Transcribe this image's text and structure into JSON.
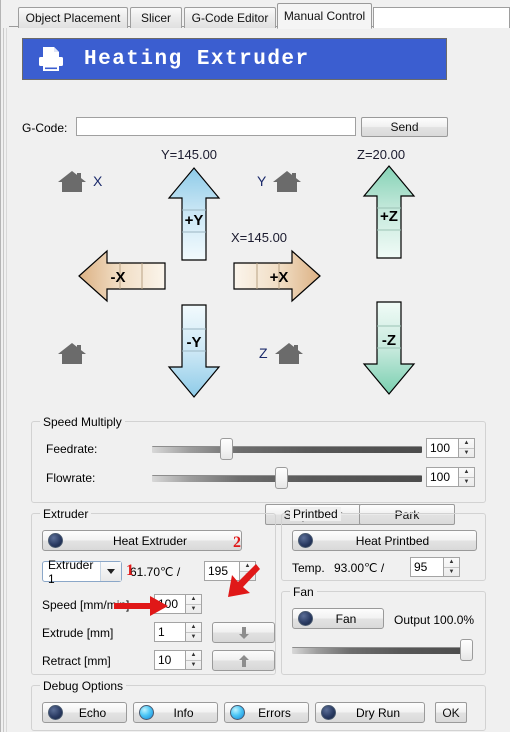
{
  "window": {
    "tabs": [
      {
        "label": "Object Placement",
        "selected": false
      },
      {
        "label": "Slicer",
        "selected": false
      },
      {
        "label": "G-Code Editor",
        "selected": false
      },
      {
        "label": "Manual Control",
        "selected": true
      }
    ]
  },
  "header": {
    "title": "Heating Extruder",
    "icon": "printer-icon",
    "bg_color": "#3b5ed0",
    "text_color": "#ffffff"
  },
  "gcode": {
    "label": "G-Code:",
    "value": "",
    "placeholder": "",
    "send_label": "Send"
  },
  "jog": {
    "readouts": {
      "x": "X=145.00",
      "y": "Y=145.00",
      "z": "Z=20.00"
    },
    "home_buttons": [
      {
        "axis_label": "X",
        "name": "home-x"
      },
      {
        "axis_label": "Y",
        "name": "home-y"
      },
      {
        "axis_label": "Z",
        "name": "home-z"
      },
      {
        "axis_label": "",
        "name": "home-all"
      }
    ],
    "arrows": [
      {
        "label": "+Y",
        "axis": "y",
        "dir": "up",
        "color": "#7fc5e8"
      },
      {
        "label": "-Y",
        "axis": "y",
        "dir": "down",
        "color": "#7fc5e8"
      },
      {
        "label": "+X",
        "axis": "x",
        "dir": "right",
        "color": "#e3bb86"
      },
      {
        "label": "-X",
        "axis": "x",
        "dir": "left",
        "color": "#e3bb86"
      },
      {
        "label": "+Z",
        "axis": "z",
        "dir": "up",
        "color": "#7fd4b6"
      },
      {
        "label": "-Z",
        "axis": "z",
        "dir": "down",
        "color": "#7fd4b6"
      }
    ],
    "stop_motor_label": "Stop Motor",
    "park_label": "Park"
  },
  "speed_multiply": {
    "caption": "Speed Multiply",
    "rows": [
      {
        "label": "Feedrate:",
        "value": "100",
        "thumb_pct": 27
      },
      {
        "label": "Flowrate:",
        "value": "100",
        "thumb_pct": 45
      }
    ]
  },
  "extruder": {
    "caption": "Extruder",
    "heat_button_label": "Heat Extruder",
    "heat_led": "off",
    "selected_extruder": "Extruder 1",
    "extruder_options": [
      "Extruder 1"
    ],
    "current_temp": "61.70℃ /",
    "target_temp": "195",
    "fields": [
      {
        "label": "Speed [mm/min]",
        "value": "100"
      },
      {
        "label": "Extrude [mm]",
        "value": "1"
      },
      {
        "label": "Retract [mm]",
        "value": "10"
      }
    ],
    "extrude_icon": "arrow-down-icon",
    "retract_icon": "arrow-up-icon"
  },
  "printbed": {
    "caption": "Printbed",
    "heat_button_label": "Heat Printbed",
    "heat_led": "off",
    "temp_label": "Temp.",
    "current_temp": "93.00℃ /",
    "target_temp": "95"
  },
  "fan": {
    "caption": "Fan",
    "button_label": "Fan",
    "led": "off",
    "output_label": "Output 100.0%",
    "slider_pct": 100
  },
  "debug": {
    "caption": "Debug Options",
    "options": [
      {
        "label": "Echo",
        "led": "off"
      },
      {
        "label": "Info",
        "led": "on"
      },
      {
        "label": "Errors",
        "led": "on"
      },
      {
        "label": "Dry Run",
        "led": "off"
      }
    ],
    "ok_label": "OK"
  },
  "annotations": [
    {
      "number": "1",
      "color": "#e01818",
      "target": "extrude-value-field"
    },
    {
      "number": "2",
      "color": "#e01818",
      "target": "extrude-send-button"
    }
  ]
}
